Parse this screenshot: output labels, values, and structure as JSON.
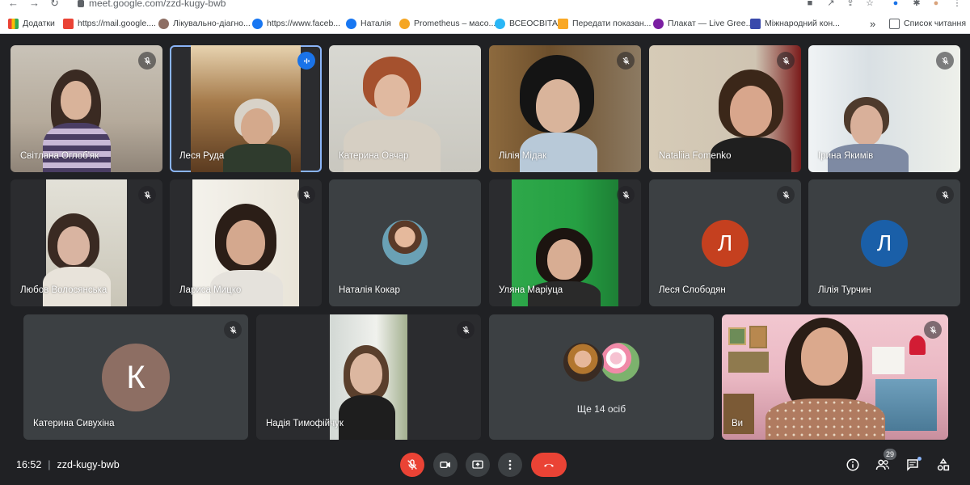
{
  "browser": {
    "url": "meet.google.com/zzd-kugy-bwb",
    "bookmarks": [
      {
        "label": "Додатки",
        "color": "#4285f4",
        "icon": "apps-icon"
      },
      {
        "label": "https://mail.google....",
        "color": "#ea4335",
        "icon": "gmail-icon"
      },
      {
        "label": "Лікувально-діагно...",
        "color": "#8d6e63",
        "icon": "heart-icon"
      },
      {
        "label": "https://www.faceb...",
        "color": "#1877f2",
        "icon": "facebook-icon"
      },
      {
        "label": "Наталія",
        "color": "#1877f2",
        "icon": "facebook-icon"
      },
      {
        "label": "Prometheus – масо...",
        "color": "#f5a623",
        "icon": "prometheus-icon"
      },
      {
        "label": "ВСЕОСВІТА",
        "color": "#29b6f6",
        "icon": "vseosvita-icon"
      },
      {
        "label": "Передати показан...",
        "color": "#f9a825",
        "icon": "104-icon"
      },
      {
        "label": "Плакат — Live Gree...",
        "color": "#7b1fa2",
        "icon": "canva-icon"
      },
      {
        "label": "Міжнародний кон...",
        "color": "#3949ab",
        "icon": "conference-icon"
      }
    ],
    "more_bookmarks": "»",
    "reading_list": "Список читання"
  },
  "participants": [
    {
      "name": "Світлана Оглоб'як",
      "muted": true,
      "kind": "video"
    },
    {
      "name": "Леся Руда",
      "muted": false,
      "speaking": true,
      "kind": "video"
    },
    {
      "name": "Катерина Овчар",
      "muted": false,
      "kind": "video"
    },
    {
      "name": "Лілія Мідак",
      "muted": true,
      "kind": "video"
    },
    {
      "name": "Nataliia Fomenko",
      "muted": true,
      "kind": "video"
    },
    {
      "name": "Ірина Якимів",
      "muted": true,
      "kind": "video"
    },
    {
      "name": "Любов Волосянська",
      "muted": true,
      "kind": "video"
    },
    {
      "name": "Лариса Мицко",
      "muted": true,
      "kind": "video"
    },
    {
      "name": "Наталія Кокар",
      "muted": false,
      "kind": "photo-avatar"
    },
    {
      "name": "Уляна Маріуца",
      "muted": true,
      "kind": "video"
    },
    {
      "name": "Леся Слободян",
      "muted": true,
      "kind": "letter-avatar",
      "letter": "Л",
      "color": "#c5401f"
    },
    {
      "name": "Лілія Турчин",
      "muted": true,
      "kind": "letter-avatar",
      "letter": "Л",
      "color": "#1a5fa8"
    },
    {
      "name": "Катерина Сивухіна",
      "muted": true,
      "kind": "letter-avatar",
      "letter": "К",
      "color": "#8d6e63"
    },
    {
      "name": "Надія Тимофійчук",
      "muted": true,
      "kind": "video"
    },
    {
      "name": "Ви",
      "muted": true,
      "kind": "video"
    }
  ],
  "more_tile": {
    "label": "Ще 14 осіб"
  },
  "bottom_bar": {
    "time": "16:52",
    "separator": "|",
    "meeting_code": "zzd-kugy-bwb",
    "participants_count": "29"
  },
  "colors": {
    "background": "#202124",
    "tile": "#3c4043",
    "accent": "#8ab4f8",
    "mute_red": "#ea4335"
  }
}
